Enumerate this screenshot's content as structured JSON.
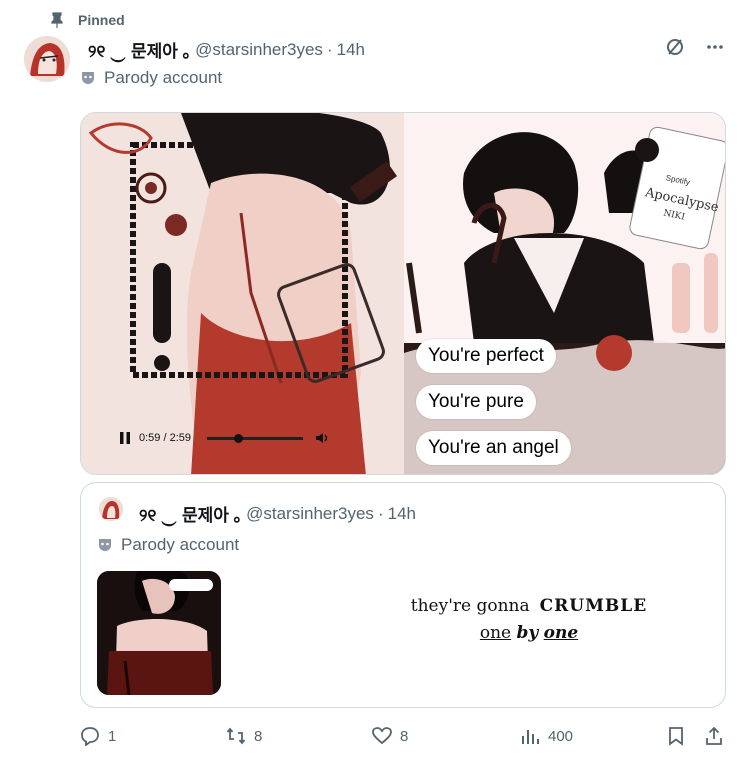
{
  "pinned": {
    "label": "Pinned",
    "icon": "pin-icon"
  },
  "post": {
    "display_name": "୨୧ ‿ 문제아 ｡",
    "handle": "@starsinher3yes",
    "separator": "·",
    "time": "14h",
    "badge_label": "Parody account",
    "badge_icon": "mask-icon",
    "media": {
      "captions": [
        "You're perfect",
        "You're pure",
        "You're an angel"
      ],
      "player_time": "0:59 / 2:59",
      "progress_fraction": 0.33,
      "album_card": {
        "source": "Spotify",
        "title": "Apocalypse",
        "artist": "NIKI"
      }
    }
  },
  "quote": {
    "display_name": "୨୧ ‿ 문제아 ｡",
    "handle": "@starsinher3yes",
    "separator": "·",
    "time": "14h",
    "badge_label": "Parody account",
    "text_line1_a": "they're gonna",
    "text_line1_b": "CRUMBLE",
    "text_line2_a": "one",
    "text_line2_b": "by",
    "text_line2_c": "one"
  },
  "actions": {
    "replies": "1",
    "reposts": "8",
    "likes": "8",
    "views": "400"
  },
  "colors": {
    "muted": "#536471",
    "text": "#0f1419",
    "border": "#cfd9de",
    "accent_red": "#b8322a"
  }
}
